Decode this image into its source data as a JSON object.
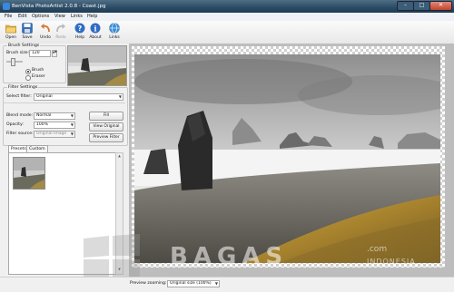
{
  "window": {
    "title": "BenVista PhotoArtist 2.0.8 - Coast.jpg",
    "controls": {
      "minimize": "–",
      "maximize": "□",
      "close": "✕"
    }
  },
  "menu": [
    "File",
    "Edit",
    "Options",
    "View",
    "Links",
    "Help"
  ],
  "toolbar": [
    {
      "label": "Open",
      "icon": "folder-icon"
    },
    {
      "label": "Save",
      "icon": "floppy-icon"
    },
    {
      "label": "Undo",
      "icon": "undo-icon"
    },
    {
      "label": "Redo",
      "icon": "redo-icon"
    },
    {
      "label": "Help",
      "icon": "help-icon"
    },
    {
      "label": "About",
      "icon": "info-icon"
    },
    {
      "label": "Links",
      "icon": "globe-icon"
    }
  ],
  "brush": {
    "group_label": "Brush Settings",
    "size_label": "Brush size:",
    "size_value": "120",
    "brush_label": "Brush",
    "eraser_label": "Eraser"
  },
  "filter": {
    "group_label": "Filter Settings",
    "select_label": "Select filter:",
    "select_value": "Original",
    "blend_label": "Blend mode:",
    "blend_value": "Normal",
    "opacity_label": "Opacity:",
    "opacity_value": "100%",
    "source_label": "Filter source:",
    "source_value": "Original Image",
    "fill_button": "Fill",
    "view_original_button": "View Original",
    "preview_filter_button": "Preview Filter"
  },
  "tabs": [
    "Presets",
    "Custom"
  ],
  "status": {
    "zoom_label": "Preview zooming:",
    "zoom_value": "Original size (100%)"
  },
  "watermark": {
    "main": "BAGAS",
    "sub": "INDONESIA",
    "com": ".com"
  },
  "colors": {
    "titlebar": "#2b4a64",
    "accent": "#3a88d8"
  }
}
